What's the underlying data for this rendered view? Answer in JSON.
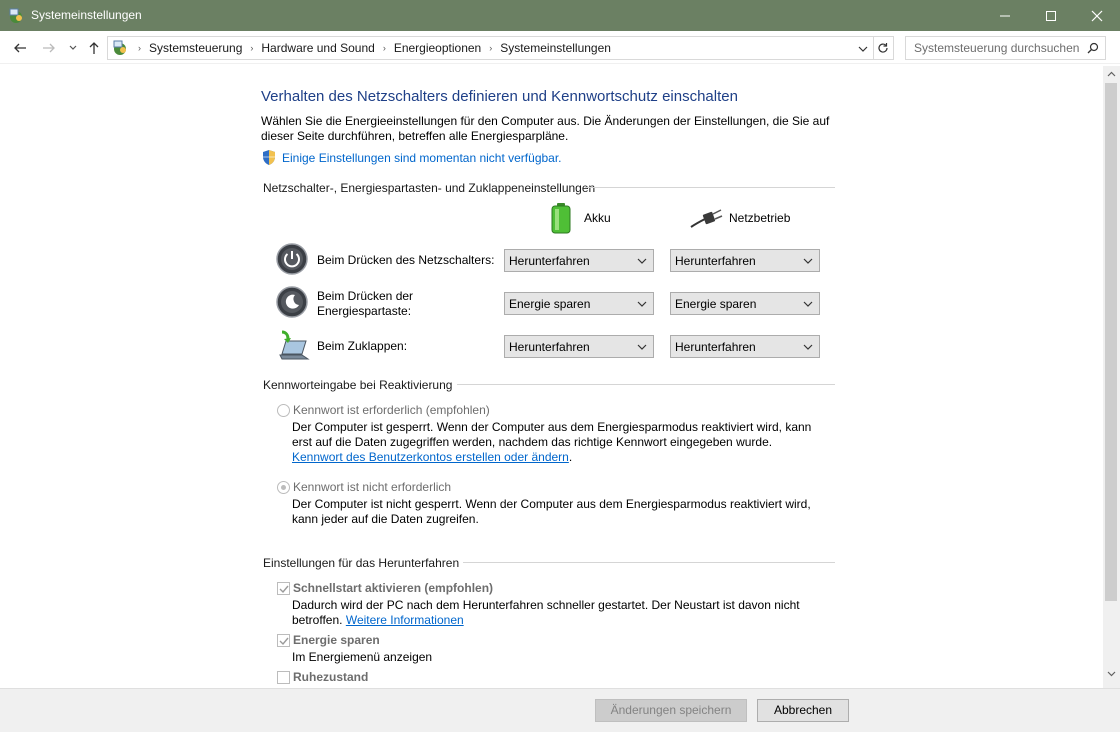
{
  "window": {
    "title": "Systemeinstellungen"
  },
  "address": {
    "breadcrumbs": [
      "Systemsteuerung",
      "Hardware und Sound",
      "Energieoptionen",
      "Systemeinstellungen"
    ],
    "search_placeholder": "Systemsteuerung durchsuchen"
  },
  "page": {
    "heading": "Verhalten des Netzschalters definieren und Kennwortschutz einschalten",
    "intro_line1": "Wählen Sie die Energieeinstellungen für den Computer aus. Die Änderungen der Einstellungen, die Sie auf",
    "intro_line2": "dieser Seite durchführen, betreffen alle Energiesparpläne.",
    "unavailable_link": "Einige Einstellungen sind momentan nicht verfügbar."
  },
  "buttons_section": {
    "title": "Netzschalter-, Energiespartasten- und Zuklappeneinstellungen",
    "col_battery": "Akku",
    "col_plugged": "Netzbetrieb",
    "rows": [
      {
        "label_line1": "Beim Drücken des Netzschalters:",
        "label_line2": "",
        "battery": "Herunterfahren",
        "plugged": "Herunterfahren"
      },
      {
        "label_line1": "Beim Drücken der",
        "label_line2": "Energiespartaste:",
        "battery": "Energie sparen",
        "plugged": "Energie sparen"
      },
      {
        "label_line1": "Beim Zuklappen:",
        "label_line2": "",
        "battery": "Herunterfahren",
        "plugged": "Herunterfahren"
      }
    ]
  },
  "password_section": {
    "title": "Kennworteingabe bei Reaktivierung",
    "option_required": {
      "label": "Kennwort ist erforderlich (empfohlen)",
      "desc_line1": "Der Computer ist gesperrt. Wenn der Computer aus dem Energiesparmodus reaktiviert wird, kann",
      "desc_line2": "erst auf die Daten zugegriffen werden, nachdem das richtige Kennwort eingegeben wurde.",
      "link": "Kennwort des Benutzerkontos erstellen oder ändern",
      "link_suffix": ".",
      "selected": false
    },
    "option_not_required": {
      "label": "Kennwort ist nicht erforderlich",
      "desc_line1": "Der Computer ist nicht gesperrt. Wenn der Computer aus dem Energiesparmodus reaktiviert wird,",
      "desc_line2": "kann jeder auf die Daten zugreifen.",
      "selected": true
    }
  },
  "shutdown_section": {
    "title": "Einstellungen für das Herunterfahren",
    "fast_startup": {
      "label": "Schnellstart aktivieren (empfohlen)",
      "desc_line1": "Dadurch wird der PC nach dem Herunterfahren schneller gestartet. Der Neustart ist davon nicht",
      "desc_line2": "betroffen.",
      "link": "Weitere Informationen",
      "checked": true
    },
    "sleep": {
      "label": "Energie sparen",
      "desc": "Im Energiemenü anzeigen",
      "checked": true
    },
    "hibernate": {
      "label": "Ruhezustand",
      "checked": false
    }
  },
  "footer": {
    "save_label": "Änderungen speichern",
    "cancel_label": "Abbrechen"
  },
  "colors": {
    "titlebar": "#6b8063",
    "heading": "#1e3f87",
    "link": "#0066cc"
  }
}
